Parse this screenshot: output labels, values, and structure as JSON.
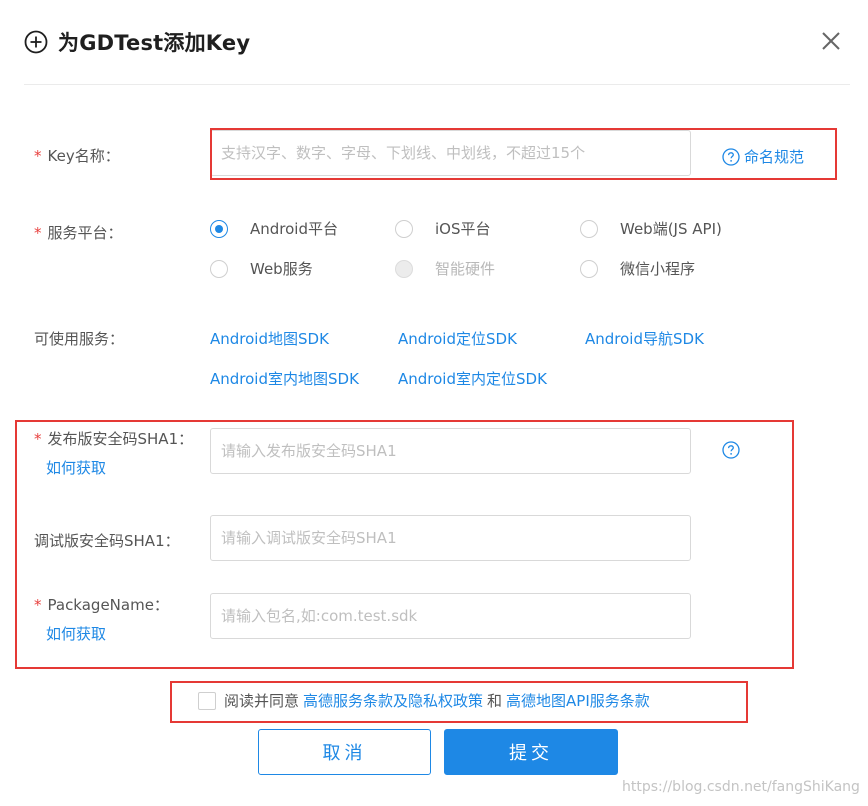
{
  "dialog": {
    "title": "为GDTest添加Key",
    "icons": {
      "title": "plus-circle-icon",
      "close": "close-icon"
    }
  },
  "form": {
    "required_mark": "*",
    "key_name": {
      "label": "Key名称：",
      "placeholder": "支持汉字、数字、字母、下划线、中划线，不超过15个",
      "help_link": "命名规范"
    },
    "platform": {
      "label": "服务平台：",
      "options": [
        {
          "label": "Android平台",
          "state": "checked"
        },
        {
          "label": "iOS平台",
          "state": "unchecked"
        },
        {
          "label": "Web端(JS API)",
          "state": "unchecked"
        },
        {
          "label": "Web服务",
          "state": "unchecked"
        },
        {
          "label": "智能硬件",
          "state": "disabled"
        },
        {
          "label": "微信小程序",
          "state": "unchecked"
        }
      ]
    },
    "services": {
      "label": "可使用服务：",
      "items": [
        "Android地图SDK",
        "Android定位SDK",
        "Android导航SDK",
        "Android室内地图SDK",
        "Android室内定位SDK"
      ]
    },
    "release_sha1": {
      "label": "发布版安全码SHA1：",
      "how_link": "如何获取",
      "placeholder": "请输入发布版安全码SHA1"
    },
    "debug_sha1": {
      "label": "调试版安全码SHA1：",
      "placeholder": "请输入调试版安全码SHA1"
    },
    "package_name": {
      "label": "PackageName：",
      "how_link": "如何获取",
      "placeholder": "请输入包名,如:com.test.sdk"
    },
    "agreement": {
      "prefix": "阅读并同意",
      "link1": "高德服务条款及隐私权政策",
      "and": "和",
      "link2": "高德地图API服务条款",
      "checked": false
    }
  },
  "buttons": {
    "cancel": "取消",
    "submit": "提交"
  },
  "watermark": "https://blog.csdn.net/fangShiKang",
  "colors": {
    "primary": "#1e88e5",
    "required": "#e8413f",
    "highlight_box": "#e53935"
  }
}
